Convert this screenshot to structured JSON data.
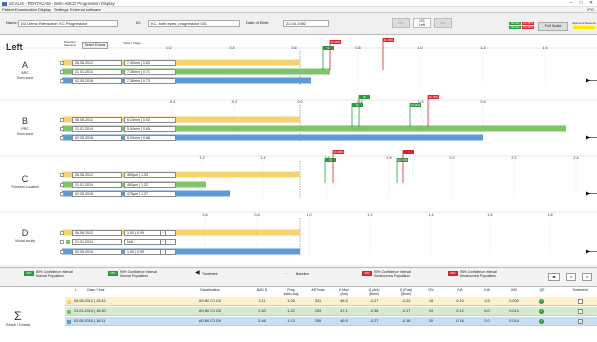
{
  "window": {
    "title": "SCALIS - PENTACAM - Belin ABCD Progression Display",
    "min": "–",
    "max": "□",
    "close": "✕"
  },
  "menu": [
    "Patient",
    "Examination",
    "Display",
    "Settings",
    "External software"
  ],
  "product": "IPG",
  "info": {
    "name_label": "Name:",
    "name_value": "D3 Demo Refractive; KC Progression",
    "id_label": "ID:",
    "id_value": "KC, both eyes, progression OD,",
    "dob_label": "Date of Birth:",
    "dob_value": "22.04.1982",
    "btn_od": "OD\nRight",
    "btn_os": "OS\nLeft",
    "btn_ou": "OU\nBoth",
    "legend_small": [
      "Normal",
      "KC 95%",
      "KC 99%",
      "Normal"
    ],
    "full_scale": "Full Scale",
    "aligned": "Aligned at Baseline"
  },
  "eye": "Left",
  "header": {
    "baseline": "Baseline\nSelection",
    "select_exams": "Select Exams",
    "value_stage": "Value | Stage"
  },
  "sections": [
    {
      "letter": "A",
      "name": "ARC",
      "sub": "3mm zone",
      "ticks": [
        "0.2",
        "0.4",
        "0.6",
        "0.8",
        "1.0",
        "1.2",
        "1.4"
      ],
      "rows": [
        {
          "date": "06.08.2012",
          "value": "7.40mm | 0.63"
        },
        {
          "date": "21.01.2014",
          "value": "7.36mm | 0.71"
        },
        {
          "date": "02.05.2016",
          "value": "7.38mm | 0.73"
        }
      ],
      "flags": [
        "NI",
        "KC 90%",
        "KC 95%"
      ]
    },
    {
      "letter": "B",
      "name": "PRC",
      "sub": "3mm zone",
      "ticks": [
        "-0.4",
        "-0.2",
        "0.0",
        "0.2",
        "0.4",
        "0.6"
      ],
      "rows": [
        {
          "date": "06.08.2012",
          "value": "6.14mm | 0.02"
        },
        {
          "date": "21.01.2014",
          "value": "5.94mm | 0.65"
        },
        {
          "date": "02.05.2016",
          "value": "6.00mm | 0.68"
        }
      ],
      "flags": [
        "NI",
        "NI",
        "KC 90%",
        "KC 95%"
      ]
    },
    {
      "letter": "C",
      "name": "Thinnest Location",
      "sub": "",
      "ticks": [
        "1.2",
        "1.4",
        "1.6",
        "1.8",
        "2.0",
        "2.2",
        "2.4"
      ],
      "rows": [
        {
          "date": "06.08.2012",
          "value": "469µm | 1.53"
        },
        {
          "date": "21.01.2014",
          "value": "481µm | 1.22"
        },
        {
          "date": "02.05.2016",
          "value": "475µm | 1.37"
        }
      ],
      "flags": [
        "NI",
        "KC 90%",
        "KC 95%"
      ]
    },
    {
      "letter": "D",
      "name": "Visual acuity",
      "sub": "",
      "ticks": [
        "0.6",
        "0.8",
        "1.0",
        "1.2",
        "1.4",
        "1.6",
        "1.8"
      ],
      "rows": [
        {
          "date": "06.08.2012",
          "value": "1.00 | 0.99"
        },
        {
          "date": "21.01.2014",
          "value": "N/A"
        },
        {
          "date": "02.05.2016",
          "value": "1.00 | 0.99"
        }
      ],
      "flags": []
    }
  ],
  "legend": {
    "items": [
      {
        "badge": "80%",
        "text": "80% Confidence Interval\nNormal Population",
        "color": "#2e9a3e"
      },
      {
        "badge": "95%",
        "text": "95% Confidence Interval\nNormal Population",
        "color": "#2e9a3e"
      },
      {
        "badge": "",
        "text": "Treatment",
        "color": "#111111"
      },
      {
        "badge": "",
        "text": "Baseline",
        "color": "#888888"
      },
      {
        "badge": "90%",
        "text": "90% Confidence Interval\nKeratoconus Population",
        "color": "#d8262c"
      },
      {
        "badge": "95%",
        "text": "95% Confidence Interval\nKeratoconus Population",
        "color": "#d8262c"
      }
    ],
    "tools": [
      "◂▸",
      "🔍",
      "🔍"
    ]
  },
  "table": {
    "sigma": "Σ",
    "result_details": "Result / Details",
    "headers": [
      "L",
      "Date / Hour",
      "Classification",
      "BAD D",
      "Prog\nIndex Avg",
      "ARTmax",
      "K Max\n(Ant)",
      "Q (Ant)\n(8mm)",
      "Q (Post)\n(8mm)",
      "ISV",
      "IVA",
      "IHA",
      "IHD",
      "QS",
      "Treatment"
    ],
    "rows": [
      {
        "date": "06.08.2012 | 15:42",
        "class": "A0 B0 C1 D0",
        "bad": "2.11",
        "prog": "1.06",
        "art": "331",
        "kmax": "46.5",
        "qa": "-0.27",
        "qp": "-0.22",
        "isv": "18",
        "iva": "0.10",
        "iha": "3.5",
        "ihd": "0.005",
        "qs": "✓",
        "treat": ""
      },
      {
        "date": "21.01.2014 | 16:30",
        "class": "A0 B0 C1 D0",
        "bad": "2.40",
        "prog": "1.22",
        "art": "293",
        "kmax": "47.1",
        "qa": "-0.38",
        "qp": "-0.17",
        "isv": "19",
        "iva": "0.12",
        "iha": "8.0",
        "ihd": "0.014",
        "qs": "✓",
        "treat": ""
      },
      {
        "date": "02.05.2016 | 16:11",
        "class": "A0 B0 C1 D0",
        "bad": "2.46",
        "prog": "1.13",
        "art": "295",
        "kmax": "46.9",
        "qa": "-0.27",
        "qp": "-0.18",
        "isv": "20",
        "iva": "0.16",
        "iha": "2.0",
        "ihd": "0.014",
        "qs": "✓",
        "treat": "✓"
      }
    ]
  },
  "colors": {
    "yellow": "#f7d46b",
    "green": "#7ec46a",
    "blue": "#5d9bd6",
    "red": "#d8262c",
    "nl_green": "#2e9a3e"
  }
}
